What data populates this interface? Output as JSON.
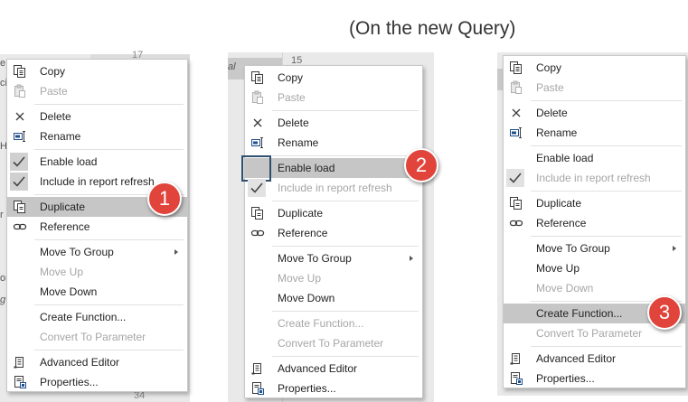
{
  "caption": "(On the new Query)",
  "background": {
    "panel1_ruler": "17",
    "panel1_bottom": "34",
    "panel1_side": [
      "e",
      "ci",
      "H",
      "r",
      "or",
      "g"
    ],
    "panel2_ruler": "15",
    "panel2_side": "al"
  },
  "menus": [
    {
      "items": [
        {
          "type": "item",
          "label": "Copy",
          "icon": "copy-icon"
        },
        {
          "type": "item",
          "label": "Paste",
          "icon": "paste-icon",
          "disabled": true
        },
        {
          "type": "sep"
        },
        {
          "type": "item",
          "label": "Delete",
          "icon": "delete-icon"
        },
        {
          "type": "item",
          "label": "Rename",
          "icon": "rename-icon"
        },
        {
          "type": "sep"
        },
        {
          "type": "item",
          "label": "Enable load",
          "icon": "check-icon"
        },
        {
          "type": "item",
          "label": "Include in report refresh",
          "icon": "check-icon"
        },
        {
          "type": "sep"
        },
        {
          "type": "item",
          "label": "Duplicate",
          "icon": "duplicate-icon",
          "highlight": true
        },
        {
          "type": "item",
          "label": "Reference",
          "icon": "reference-icon"
        },
        {
          "type": "sep"
        },
        {
          "type": "item",
          "label": "Move To Group",
          "submenu": true
        },
        {
          "type": "item",
          "label": "Move Up",
          "disabled": true
        },
        {
          "type": "item",
          "label": "Move Down"
        },
        {
          "type": "sep"
        },
        {
          "type": "item",
          "label": "Create Function..."
        },
        {
          "type": "item",
          "label": "Convert To Parameter",
          "disabled": true
        },
        {
          "type": "sep"
        },
        {
          "type": "item",
          "label": "Advanced Editor",
          "icon": "advanced-editor-icon"
        },
        {
          "type": "item",
          "label": "Properties...",
          "icon": "properties-icon"
        }
      ],
      "badge": "1"
    },
    {
      "items": [
        {
          "type": "item",
          "label": "Copy",
          "icon": "copy-icon"
        },
        {
          "type": "item",
          "label": "Paste",
          "icon": "paste-icon",
          "disabled": true
        },
        {
          "type": "sep"
        },
        {
          "type": "item",
          "label": "Delete",
          "icon": "delete-icon"
        },
        {
          "type": "item",
          "label": "Rename",
          "icon": "rename-icon"
        },
        {
          "type": "sep"
        },
        {
          "type": "item",
          "label": "Enable load",
          "icon": "unchecked-box-icon",
          "highlight": true
        },
        {
          "type": "item",
          "label": "Include in report refresh",
          "icon": "check-icon",
          "disabled": true
        },
        {
          "type": "sep"
        },
        {
          "type": "item",
          "label": "Duplicate",
          "icon": "duplicate-icon"
        },
        {
          "type": "item",
          "label": "Reference",
          "icon": "reference-icon"
        },
        {
          "type": "sep"
        },
        {
          "type": "item",
          "label": "Move To Group",
          "submenu": true
        },
        {
          "type": "item",
          "label": "Move Up",
          "disabled": true
        },
        {
          "type": "item",
          "label": "Move Down"
        },
        {
          "type": "sep"
        },
        {
          "type": "item",
          "label": "Create Function...",
          "disabled": true
        },
        {
          "type": "item",
          "label": "Convert To Parameter",
          "disabled": true
        },
        {
          "type": "sep"
        },
        {
          "type": "item",
          "label": "Advanced Editor",
          "icon": "advanced-editor-icon"
        },
        {
          "type": "item",
          "label": "Properties...",
          "icon": "properties-icon"
        }
      ],
      "badge": "2"
    },
    {
      "items": [
        {
          "type": "item",
          "label": "Copy",
          "icon": "copy-icon"
        },
        {
          "type": "item",
          "label": "Paste",
          "icon": "paste-icon",
          "disabled": true
        },
        {
          "type": "sep"
        },
        {
          "type": "item",
          "label": "Delete",
          "icon": "delete-icon"
        },
        {
          "type": "item",
          "label": "Rename",
          "icon": "rename-icon"
        },
        {
          "type": "sep"
        },
        {
          "type": "item",
          "label": "Enable load"
        },
        {
          "type": "item",
          "label": "Include in report refresh",
          "icon": "check-icon",
          "disabled": true
        },
        {
          "type": "sep"
        },
        {
          "type": "item",
          "label": "Duplicate",
          "icon": "duplicate-icon"
        },
        {
          "type": "item",
          "label": "Reference",
          "icon": "reference-icon"
        },
        {
          "type": "sep"
        },
        {
          "type": "item",
          "label": "Move To Group",
          "submenu": true
        },
        {
          "type": "item",
          "label": "Move Up"
        },
        {
          "type": "item",
          "label": "Move Down",
          "disabled": true
        },
        {
          "type": "sep"
        },
        {
          "type": "item",
          "label": "Create Function...",
          "highlight": true
        },
        {
          "type": "item",
          "label": "Convert To Parameter",
          "disabled": true
        },
        {
          "type": "sep"
        },
        {
          "type": "item",
          "label": "Advanced Editor",
          "icon": "advanced-editor-icon"
        },
        {
          "type": "item",
          "label": "Properties...",
          "icon": "properties-icon"
        }
      ],
      "badge": "3"
    }
  ],
  "colors": {
    "highlight": "#c6c6c6",
    "badge": "#e0443a",
    "disabled_text": "#a6a6a6"
  }
}
